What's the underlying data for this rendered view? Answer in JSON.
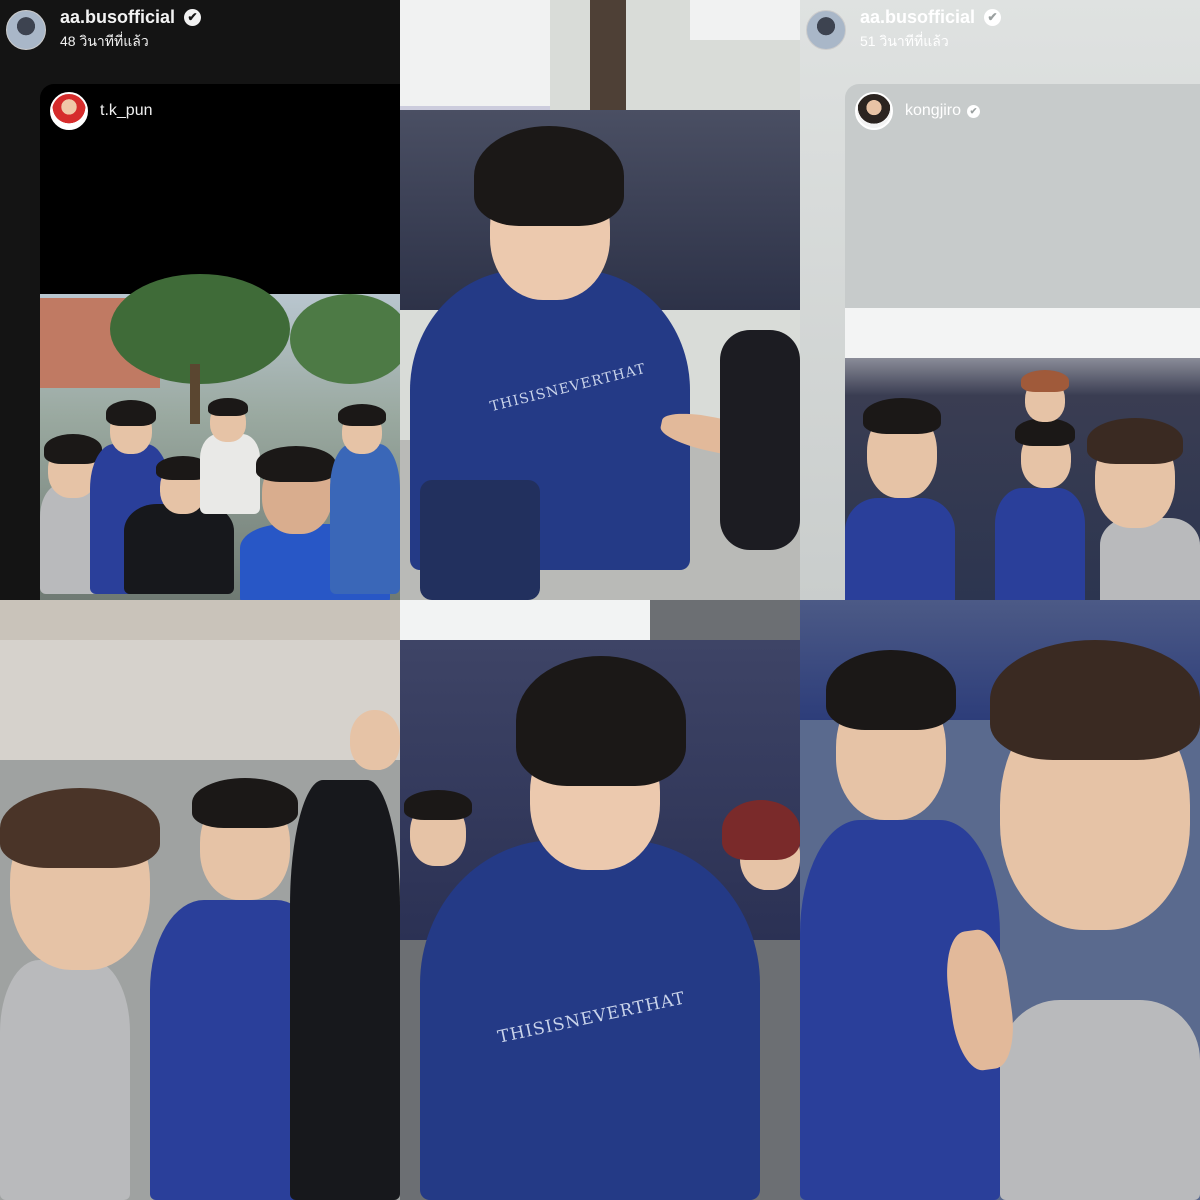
{
  "story_left": {
    "username": "aa.busofficial",
    "time": "48 วินาทีที่แล้ว",
    "shared_user": "t.k_pun"
  },
  "story_right": {
    "username": "aa.busofficial",
    "time": "51 วินาทีที่แล้ว",
    "shared_user": "kongjiro"
  },
  "icons": {
    "verified": "✔"
  },
  "shirt_print": {
    "center_top": "THISISNEVERTHAT",
    "center_bottom": "THISISNEVERTHAT"
  },
  "colors": {
    "dark_panel": "#141414",
    "light_panel": "#d8dcdb",
    "shirt_blue": "#2a3f9a"
  }
}
